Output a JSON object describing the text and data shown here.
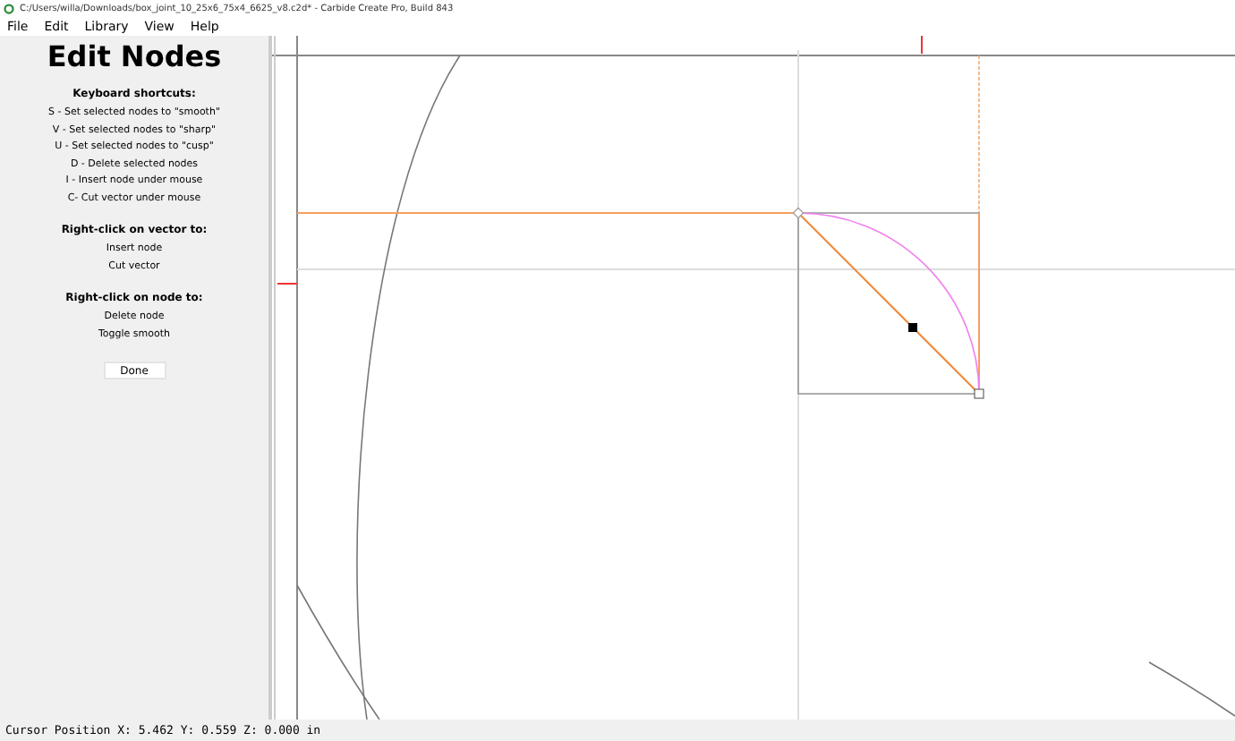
{
  "window": {
    "title": "C:/Users/willa/Downloads/box_joint_10_25x6_75x4_6625_v8.c2d* - Carbide Create Pro, Build 843"
  },
  "menu": [
    "File",
    "Edit",
    "Library",
    "View",
    "Help"
  ],
  "panel": {
    "title": "Edit Nodes",
    "sections": [
      {
        "heading": "Keyboard shortcuts:",
        "items": [
          "S - Set selected nodes to \"smooth\"",
          "V - Set selected nodes to \"sharp\"",
          "U - Set selected nodes to \"cusp\"",
          "D - Delete selected nodes",
          "I - Insert node under mouse",
          "C- Cut vector under mouse"
        ]
      },
      {
        "heading": "Right-click on vector to:",
        "items": [
          "Insert node",
          "Cut vector"
        ]
      },
      {
        "heading": "Right-click on node to:",
        "items": [
          "Delete node",
          "Toggle smooth"
        ]
      }
    ],
    "button": "Done"
  },
  "status_bar": "Cursor Position X: 5.462 Y: 0.559 Z: 0.000 in"
}
